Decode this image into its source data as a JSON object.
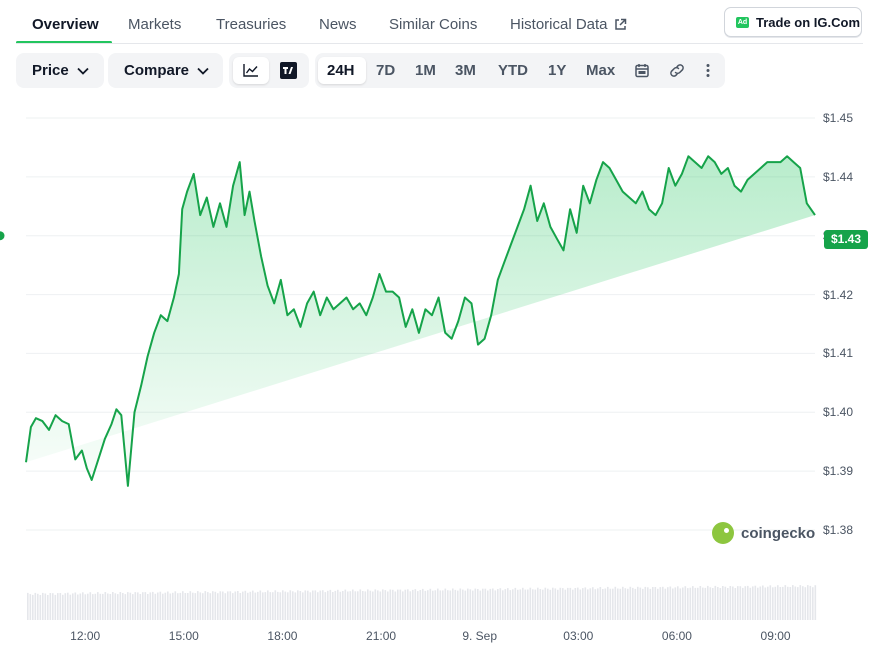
{
  "tabs": [
    {
      "label": "Overview",
      "active": true
    },
    {
      "label": "Markets"
    },
    {
      "label": "Treasuries"
    },
    {
      "label": "News"
    },
    {
      "label": "Similar Coins"
    },
    {
      "label": "Historical Data"
    }
  ],
  "ad_button": {
    "badge": "Ad",
    "label": "Trade on IG.Com"
  },
  "toolbar": {
    "price_dropdown": "Price",
    "compare_dropdown": "Compare",
    "chart_modes": [
      {
        "icon": "line-chart-icon",
        "selected": true
      },
      {
        "icon": "tradingview-icon"
      }
    ],
    "ranges": [
      "24H",
      "7D",
      "1M",
      "3M",
      "YTD",
      "1Y",
      "Max"
    ],
    "active_range": "24H",
    "extra_icons": [
      "calendar-icon",
      "link-icon",
      "more-vertical-icon"
    ]
  },
  "current_price_label": "$1.43",
  "watermark": "coingecko",
  "colors": {
    "line": "#16a34a",
    "accent": "#22c55e",
    "fill_top": "#22c55e"
  },
  "chart_data": {
    "type": "area",
    "title": "",
    "xlabel": "",
    "ylabel": "",
    "ylim": [
      1.38,
      1.45
    ],
    "y_ticks": [
      "$1.45",
      "$1.44",
      "$1.43",
      "$1.42",
      "$1.41",
      "$1.40",
      "$1.39",
      "$1.38"
    ],
    "x_ticks": [
      "12:00",
      "15:00",
      "18:00",
      "21:00",
      "9. Sep",
      "03:00",
      "06:00",
      "09:00"
    ],
    "x_tick_hours": [
      12,
      15,
      18,
      21,
      24,
      27,
      30,
      33
    ],
    "x_range_hours": [
      10.2,
      34.2
    ],
    "series": [
      {
        "values_hours": [
          10.2,
          10.35,
          10.5,
          10.7,
          10.9,
          11.1,
          11.3,
          11.5,
          11.7,
          11.9,
          12.05,
          12.2,
          12.4,
          12.6,
          12.8,
          12.95,
          13.1,
          13.3,
          13.5,
          13.7,
          13.9,
          14.1,
          14.3,
          14.5,
          14.7,
          14.85,
          14.95,
          15.1,
          15.3,
          15.5,
          15.7,
          15.9,
          16.1,
          16.3,
          16.5,
          16.7,
          16.85,
          17.0,
          17.15,
          17.35,
          17.55,
          17.75,
          17.95,
          18.15,
          18.35,
          18.55,
          18.75,
          18.95,
          19.15,
          19.35,
          19.55,
          19.75,
          19.95,
          20.15,
          20.35,
          20.55,
          20.75,
          20.95,
          21.15,
          21.35,
          21.55,
          21.75,
          21.95,
          22.15,
          22.35,
          22.55,
          22.75,
          22.95,
          23.15,
          23.35,
          23.55,
          23.75,
          23.95,
          24.15,
          24.35,
          24.55,
          24.75,
          24.95,
          25.15,
          25.35,
          25.55,
          25.75,
          25.95,
          26.15,
          26.35,
          26.55,
          26.75,
          26.95,
          27.15,
          27.35,
          27.55,
          27.75,
          27.95,
          28.15,
          28.35,
          28.55,
          28.75,
          28.95,
          29.15,
          29.35,
          29.55,
          29.75,
          29.95,
          30.15,
          30.35,
          30.55,
          30.75,
          30.95,
          31.15,
          31.35,
          31.55,
          31.75,
          31.95,
          32.15,
          32.35,
          32.55,
          32.75,
          32.95,
          33.15,
          33.35,
          33.55,
          33.75,
          33.95,
          34.2
        ],
        "values": [
          1.3915,
          1.3975,
          1.399,
          1.3985,
          1.397,
          1.3995,
          1.3985,
          1.398,
          1.392,
          1.3935,
          1.3905,
          1.3885,
          1.392,
          1.3955,
          1.398,
          1.4005,
          1.3995,
          1.3875,
          1.4,
          1.4045,
          1.4095,
          1.4135,
          1.4165,
          1.4155,
          1.4195,
          1.4235,
          1.4345,
          1.4375,
          1.4405,
          1.4335,
          1.4365,
          1.4315,
          1.4355,
          1.4315,
          1.4385,
          1.4425,
          1.4335,
          1.4375,
          1.4325,
          1.4265,
          1.4215,
          1.4185,
          1.4225,
          1.4165,
          1.4175,
          1.4145,
          1.4185,
          1.4205,
          1.4165,
          1.4195,
          1.4175,
          1.4185,
          1.4195,
          1.4175,
          1.4185,
          1.4165,
          1.4195,
          1.4235,
          1.4205,
          1.4205,
          1.4195,
          1.4145,
          1.4175,
          1.4135,
          1.4175,
          1.4165,
          1.4195,
          1.4135,
          1.4125,
          1.4155,
          1.4195,
          1.4185,
          1.4115,
          1.4125,
          1.4165,
          1.4225,
          1.4255,
          1.4285,
          1.4315,
          1.4345,
          1.4385,
          1.4325,
          1.4355,
          1.4315,
          1.4295,
          1.4275,
          1.4345,
          1.4305,
          1.4385,
          1.4355,
          1.4395,
          1.4425,
          1.4415,
          1.4395,
          1.4375,
          1.4365,
          1.4355,
          1.4375,
          1.4345,
          1.4335,
          1.4355,
          1.4415,
          1.4385,
          1.4405,
          1.4435,
          1.4425,
          1.4415,
          1.4435,
          1.4425,
          1.4405,
          1.4415,
          1.4385,
          1.4375,
          1.4395,
          1.4405,
          1.4415,
          1.4425,
          1.4425,
          1.4425,
          1.4435,
          1.4425,
          1.4415,
          1.4355,
          1.4335,
          1.4325,
          1.4315,
          1.43
        ]
      }
    ],
    "volume_shown": true
  }
}
